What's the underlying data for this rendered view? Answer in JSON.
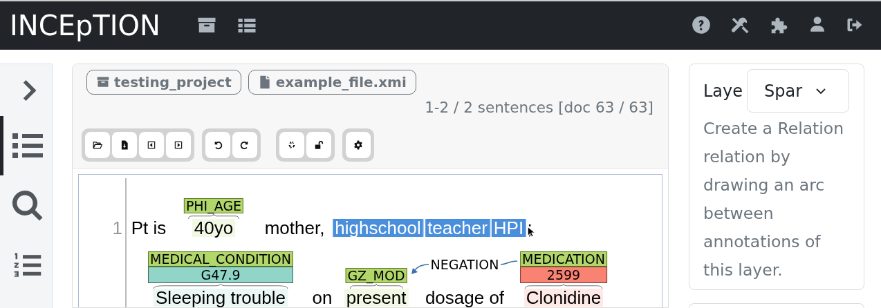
{
  "app": {
    "title": "INCEpTION"
  },
  "sidebar": {
    "items": [
      {
        "kind": "expand",
        "selected": false
      },
      {
        "kind": "annotations",
        "selected": true
      },
      {
        "kind": "search",
        "selected": false
      },
      {
        "kind": "list",
        "selected": false
      }
    ]
  },
  "breadcrumbs": [
    {
      "kind": "project",
      "label": "testing_project"
    },
    {
      "kind": "document",
      "label": "example_file.xmi"
    }
  ],
  "position": "1-2 / 2 sentences [doc 63 / 63]",
  "sentences": [
    {
      "number": "1",
      "tokens": [
        {
          "text": "Pt is",
          "selected": false
        },
        {
          "text": "40yo",
          "selected": false,
          "spans": [
            {
              "label": "PHI_AGE"
            }
          ]
        },
        {
          "text": "mother,",
          "selected": false
        },
        {
          "text": "highschool",
          "selected": true
        },
        {
          "text": "teacher",
          "selected": true
        },
        {
          "text": "HPI",
          "selected": true
        },
        {
          "text": ";",
          "selected": false
        }
      ]
    },
    {
      "tokens": [
        {
          "text": "Sleeping trouble",
          "selected": false,
          "spans": [
            {
              "label": "MEDICAL_CONDITION",
              "value": "G47.9",
              "color": "#90d5c7"
            }
          ]
        },
        {
          "text": "on",
          "selected": false
        },
        {
          "text": "present",
          "selected": false,
          "spans": [
            {
              "label": "GZ_MOD"
            }
          ]
        },
        {
          "text": "dosage of",
          "selected": false
        },
        {
          "text": "Clonidine",
          "selected": false,
          "spans": [
            {
              "label": "MEDICATION",
              "value": "2599",
              "color": "#f98272"
            }
          ]
        }
      ],
      "relations": [
        {
          "label": "NEGATION"
        }
      ]
    }
  ],
  "layer_panel": {
    "label": "Laye",
    "layer": "Spar",
    "description": "Create a Relation relation by drawing an arc between annotations of this layer."
  }
}
